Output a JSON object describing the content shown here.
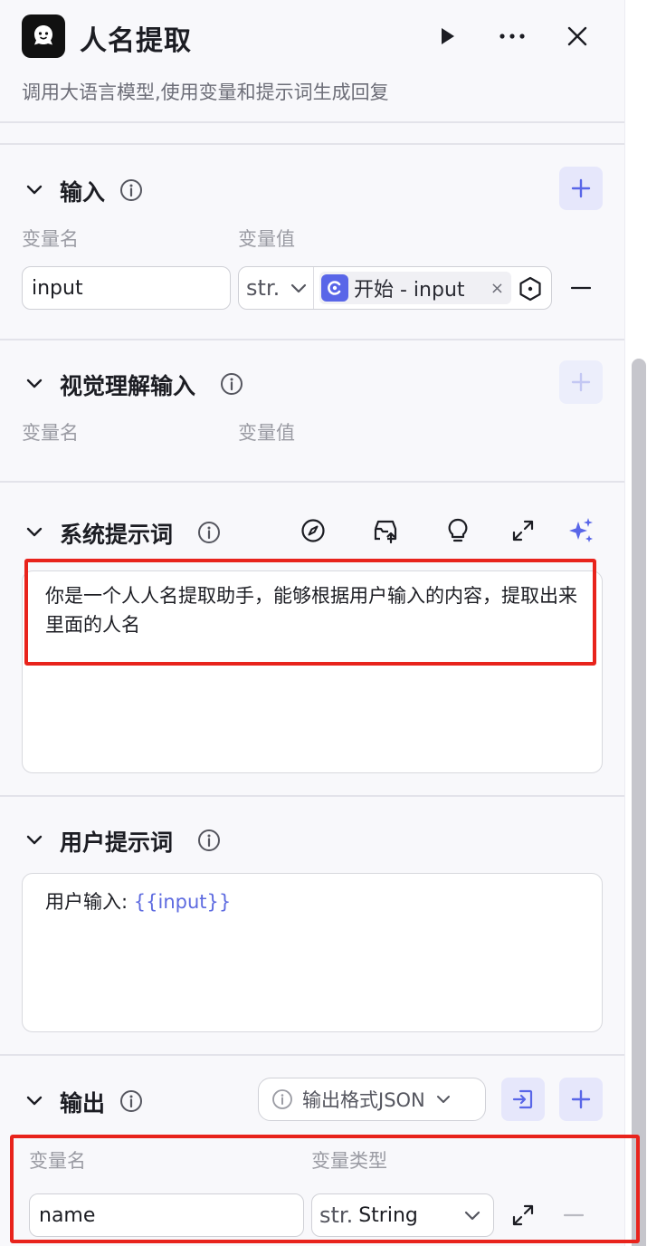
{
  "header": {
    "title": "人名提取",
    "subtitle": "调用大语言模型,使用变量和提示词生成回复"
  },
  "input_section": {
    "title": "输入",
    "col_name": "变量名",
    "col_value": "变量值",
    "row": {
      "name": "input",
      "type": "str.",
      "ref_label": "开始 - input",
      "ref_remove": "×"
    }
  },
  "vision_section": {
    "title": "视觉理解输入",
    "col_name": "变量名",
    "col_value": "变量值"
  },
  "system_prompt": {
    "title": "系统提示词",
    "text": "你是一个人人名提取助手，能够根据用户输入的内容，提取出来里面的人名"
  },
  "user_prompt": {
    "title": "用户提示词",
    "prefix": "用户输入: ",
    "variable": "{{input}}"
  },
  "output_section": {
    "title": "输出",
    "format_label": "输出格式JSON",
    "col_name": "变量名",
    "col_type": "变量类型",
    "row": {
      "name": "name",
      "type_prefix": "str.",
      "type_name": "String"
    }
  },
  "colors": {
    "accent": "#5966e8",
    "highlight_border": "#e8231c"
  }
}
